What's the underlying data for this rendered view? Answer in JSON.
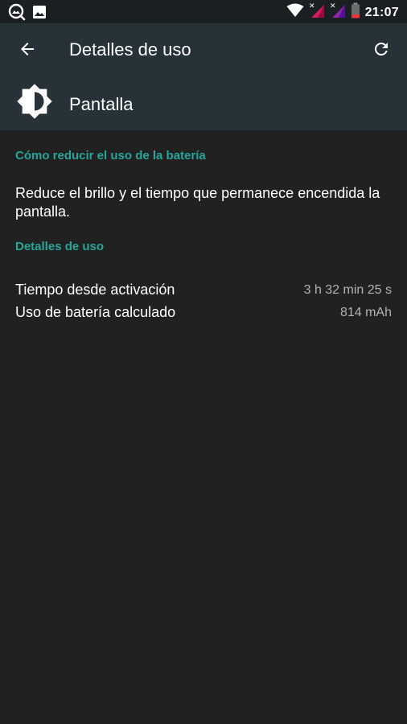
{
  "status_bar": {
    "time": "21:07",
    "icons": [
      "photo-search-icon",
      "image-icon",
      "wifi-icon",
      "signal-1-icon",
      "signal-2-icon",
      "battery-icon"
    ]
  },
  "toolbar": {
    "title": "Detalles de uso",
    "back_icon": "arrow-back-icon",
    "refresh_icon": "refresh-icon"
  },
  "header": {
    "icon": "brightness-icon",
    "title": "Pantalla"
  },
  "tips": {
    "section_title": "Cómo reducir el uso de la batería",
    "text": "Reduce el brillo y el tiempo que permanece encendida la pantalla."
  },
  "usage": {
    "section_title": "Detalles de uso",
    "rows": [
      {
        "label": "Tiempo desde activación",
        "value": "3 h 32 min 25 s"
      },
      {
        "label": "Uso de batería calculado",
        "value": "814 mAh"
      }
    ]
  },
  "colors": {
    "appbar": "#263238",
    "background": "#212121",
    "accent": "#26a69a",
    "secondary_text": "#b3b3b3",
    "signal_pink": "#d81b60",
    "signal_purple": "#6a1b9a",
    "battery_red": "#e53935"
  }
}
